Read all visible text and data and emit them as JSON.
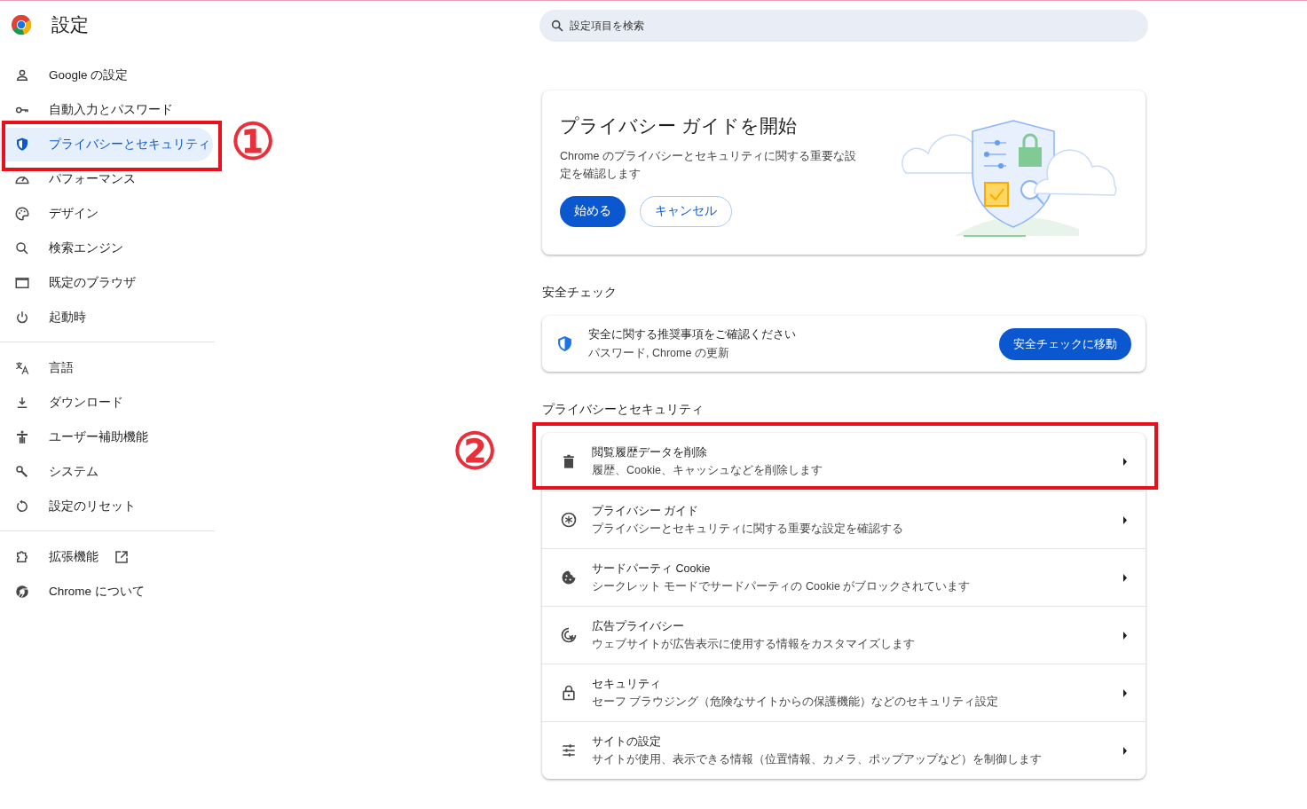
{
  "header": {
    "title": "設定"
  },
  "search": {
    "placeholder": "設定項目を検索"
  },
  "sidebar": {
    "groups": [
      {
        "items": [
          {
            "label": "Google の設定",
            "selected": false,
            "kind": "link"
          },
          {
            "label": "自動入力とパスワード",
            "selected": false,
            "kind": "link"
          },
          {
            "label": "プライバシーとセキュリティ",
            "selected": true,
            "kind": "link"
          },
          {
            "label": "パフォーマンス",
            "selected": false,
            "kind": "link"
          },
          {
            "label": "デザイン",
            "selected": false,
            "kind": "link"
          },
          {
            "label": "検索エンジン",
            "selected": false,
            "kind": "link"
          },
          {
            "label": "既定のブラウザ",
            "selected": false,
            "kind": "link"
          },
          {
            "label": "起動時",
            "selected": false,
            "kind": "link"
          }
        ]
      },
      {
        "items": [
          {
            "label": "言語",
            "selected": false,
            "kind": "link"
          },
          {
            "label": "ダウンロード",
            "selected": false,
            "kind": "link"
          },
          {
            "label": "ユーザー補助機能",
            "selected": false,
            "kind": "link"
          },
          {
            "label": "システム",
            "selected": false,
            "kind": "link"
          },
          {
            "label": "設定のリセット",
            "selected": false,
            "kind": "link"
          }
        ]
      },
      {
        "items": [
          {
            "label": "拡張機能",
            "selected": false,
            "kind": "external"
          },
          {
            "label": "Chrome について",
            "selected": false,
            "kind": "link"
          }
        ]
      }
    ]
  },
  "guide_card": {
    "title": "プライバシー ガイドを開始",
    "description": "Chrome のプライバシーとセキュリティに関する重要な設定を確認します",
    "buttons": [
      {
        "label": "始める",
        "kind": "primary"
      },
      {
        "label": "キャンセル",
        "kind": "outline"
      }
    ]
  },
  "safety_check": {
    "heading": "安全チェック",
    "title": "安全に関する推奨事項をご確認ください",
    "subtitle": "パスワード, Chrome の更新",
    "button": "安全チェックに移動"
  },
  "privacy_section": {
    "heading": "プライバシーとセキュリティ",
    "rows": [
      {
        "title": "閲覧履歴データを削除",
        "subtitle": "履歴、Cookie、キャッシュなどを削除します"
      },
      {
        "title": "プライバシー ガイド",
        "subtitle": "プライバシーとセキュリティに関する重要な設定を確認する"
      },
      {
        "title": "サードパーティ Cookie",
        "subtitle": "シークレット モードでサードパーティの Cookie がブロックされています"
      },
      {
        "title": "広告プライバシー",
        "subtitle": "ウェブサイトが広告表示に使用する情報をカスタマイズします"
      },
      {
        "title": "セキュリティ",
        "subtitle": "セーフ ブラウジング（危険なサイトからの保護機能）などのセキュリティ設定"
      },
      {
        "title": "サイトの設定",
        "subtitle": "サイトが使用、表示できる情報（位置情報、カメラ、ポップアップなど）を制御します"
      }
    ]
  },
  "annotations": [
    {
      "label": "①"
    },
    {
      "label": "②"
    }
  ]
}
